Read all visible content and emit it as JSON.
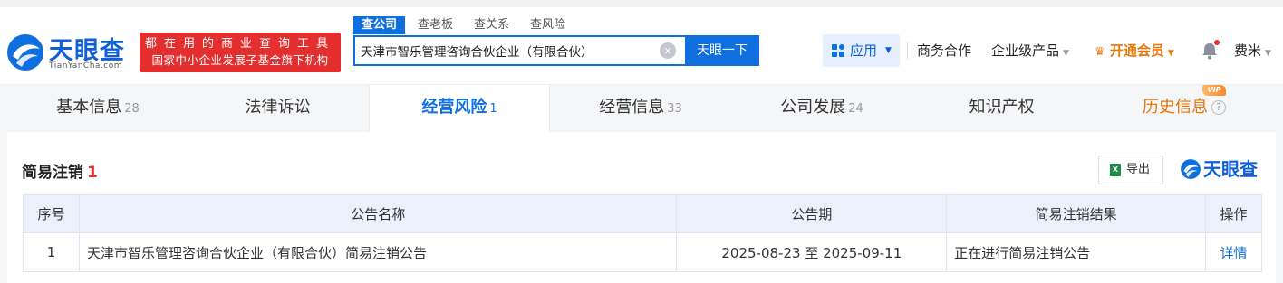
{
  "header": {
    "logo": {
      "name": "天眼查",
      "domain": "TianYanCha.com"
    },
    "slogan": {
      "line1": "都在用的商业查询工具",
      "line2": "国家中小企业发展子基金旗下机构"
    },
    "search_tabs": [
      "查公司",
      "查老板",
      "查关系",
      "查风险"
    ],
    "search_value": "天津市智乐管理咨询合伙企业（有限合伙）",
    "search_button": "天眼一下",
    "nav": {
      "apps": "应用",
      "business": "商务合作",
      "enterprise": "企业级产品",
      "vip": "开通会员",
      "user": "费米"
    }
  },
  "tabs": [
    {
      "label": "基本信息",
      "count": "28"
    },
    {
      "label": "法律诉讼",
      "count": ""
    },
    {
      "label": "经营风险",
      "count": "1"
    },
    {
      "label": "经营信息",
      "count": "33"
    },
    {
      "label": "公司发展",
      "count": "24"
    },
    {
      "label": "知识产权",
      "count": ""
    },
    {
      "label": "历史信息",
      "count": ""
    }
  ],
  "vip_badge": "VIP",
  "section": {
    "title": "简易注销",
    "count": "1",
    "export_label": "导出",
    "export_icon_text": "X",
    "watermark": "天眼查"
  },
  "table": {
    "headers": [
      "序号",
      "公告名称",
      "公告期",
      "简易注销结果",
      "操作"
    ],
    "rows": [
      {
        "no": "1",
        "name": "天津市智乐管理咨询合伙企业（有限合伙）简易注销公告",
        "period": "2025-08-23 至 2025-09-11",
        "result": "正在进行简易注销公告",
        "action": "详情"
      }
    ]
  },
  "colors": {
    "brand": "#0f6fde",
    "red": "#e52e2e",
    "vip": "#e8760b"
  },
  "icons": [
    "tianyancha-logo-icon",
    "clear-icon",
    "apps-grid-icon",
    "caret-down-icon",
    "crown-icon",
    "bell-icon",
    "help-icon",
    "excel-icon"
  ]
}
